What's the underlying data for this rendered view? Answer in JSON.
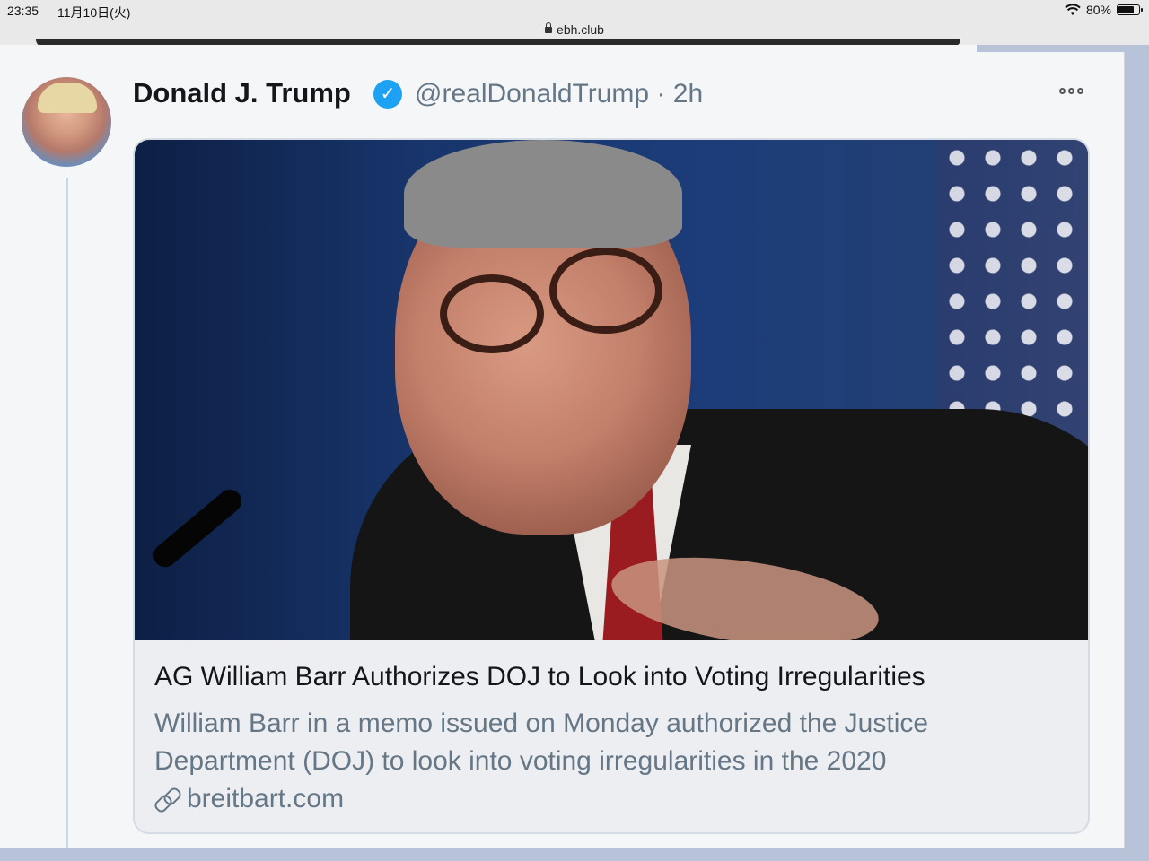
{
  "status_bar": {
    "time": "23:35",
    "date": "11月10日(火)",
    "battery": "80%",
    "battery_level": 0.8,
    "url": "ebh.club"
  },
  "tweet": {
    "display_name": "Donald J. Trump",
    "verified": true,
    "handle_time": "@realDonaldTrump · 2h",
    "card": {
      "title": "AG William Barr Authorizes DOJ to Look into Voting Irregularities",
      "description": "William Barr in a memo issued on Monday authorized the Justice Department (DOJ) to look into voting irregularities in the 2020",
      "domain": "breitbart.com"
    }
  },
  "icons": [
    "wifi-icon",
    "battery-icon",
    "lock-icon",
    "verified-icon",
    "more-icon",
    "link-icon"
  ],
  "colors": {
    "verified_blue": "#1da1f2",
    "secondary_text": "#657786"
  }
}
